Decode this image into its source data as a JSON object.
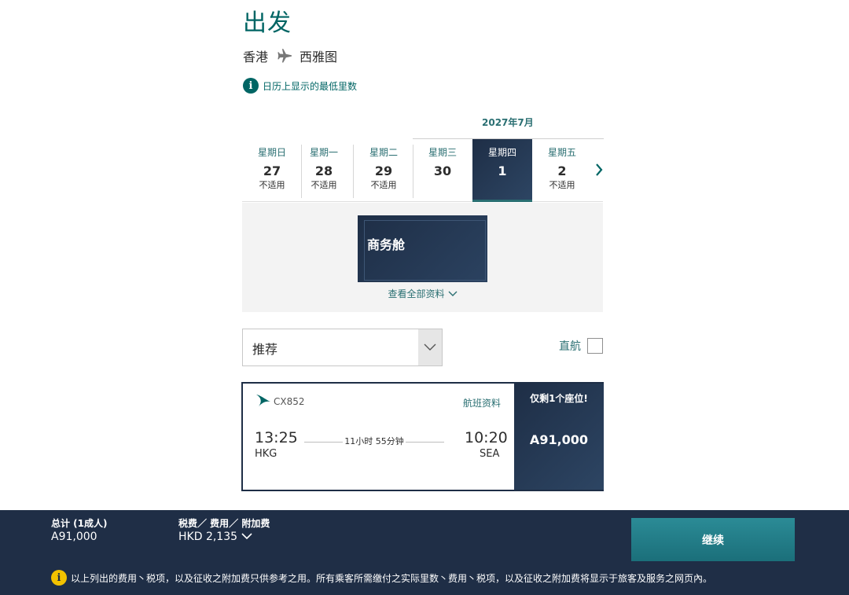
{
  "page": {
    "title": "出发"
  },
  "route": {
    "origin": "香港",
    "destination": "西雅图",
    "icon": "plane-icon"
  },
  "info": {
    "icon": "info-icon",
    "text": "日历上显示的最低里数"
  },
  "calendar": {
    "month_label": "2027年7月",
    "days": [
      {
        "weekday": "星期日",
        "date": "27",
        "note": "不适用",
        "selected": false
      },
      {
        "weekday": "星期一",
        "date": "28",
        "note": "不适用",
        "selected": false
      },
      {
        "weekday": "星期二",
        "date": "29",
        "note": "不适用",
        "selected": false
      },
      {
        "weekday": "星期三",
        "date": "30",
        "note": "",
        "selected": false
      },
      {
        "weekday": "星期四",
        "date": "1",
        "note": "",
        "selected": true
      },
      {
        "weekday": "星期五",
        "date": "2",
        "note": "不适用",
        "selected": false
      }
    ],
    "next_icon": "chevron-right-icon"
  },
  "cabin": {
    "label": "商务舱",
    "see_all": "查看全部资料"
  },
  "filters": {
    "sort_value": "推荐",
    "nonstop_label": "直航",
    "nonstop_checked": false
  },
  "flight": {
    "number": "CX852",
    "details_link": "航班资料",
    "dep_time": "13:25",
    "dep_code": "HKG",
    "duration": "11小时 55分钟",
    "arr_time": "10:20",
    "arr_code": "SEA",
    "seats_left": "仅剩1个座位!",
    "price": "91,000",
    "price_icon": "asia-miles-icon"
  },
  "footer": {
    "total_label": "总计 (1成人)",
    "total_value": "91,000",
    "tax_label": "税费／ 费用／ 附加费",
    "tax_value": "HKD 2,135",
    "continue_label": "继续",
    "note": "以上列出的费用丶税项，以及征收之附加费只供参考之用。所有乘客所需缴付之实际里数丶费用丶税项，以及征收之附加费将显示于旅客及服务之网页內。"
  },
  "colors": {
    "brand_teal": "#006564",
    "navy": "#1f2e46",
    "button_teal": "#1b6f7a",
    "warning": "#f2c200"
  }
}
